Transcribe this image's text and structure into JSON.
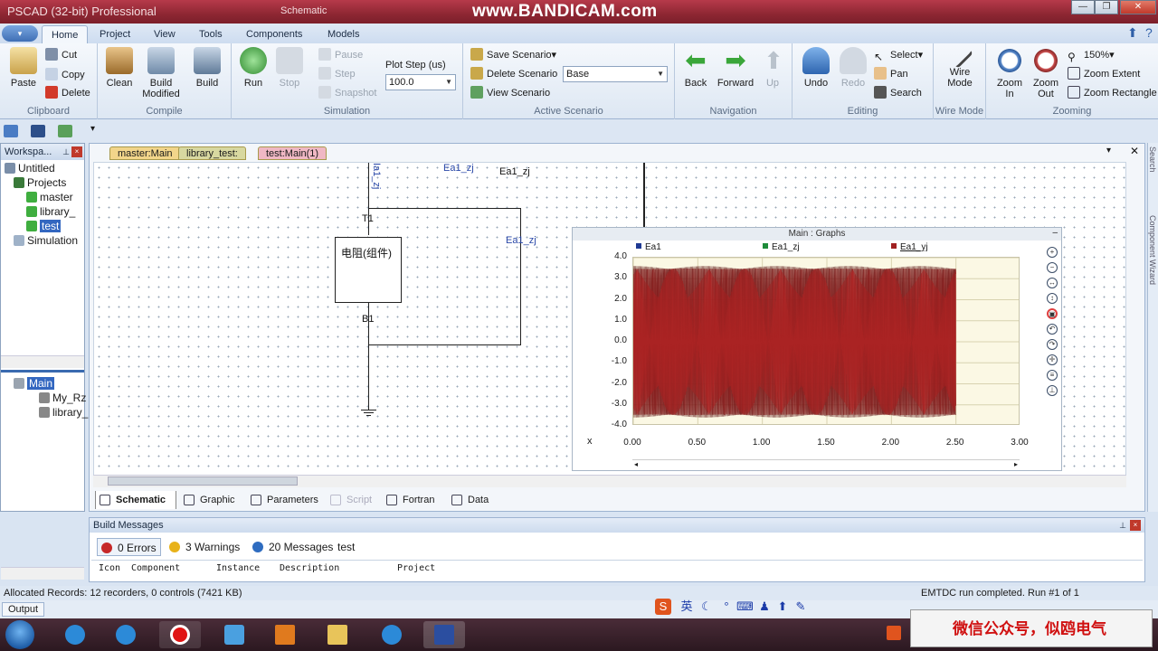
{
  "window": {
    "app_title": "PSCAD (32-bit) Professional",
    "doc_title": "Schematic",
    "watermark": "www.BANDICAM.com"
  },
  "ribbon_tabs": [
    "Home",
    "Project",
    "View",
    "Tools",
    "Components",
    "Models"
  ],
  "ribbon": {
    "clipboard": {
      "label": "Clipboard",
      "paste": "Paste",
      "cut": "Cut",
      "copy": "Copy",
      "delete": "Delete"
    },
    "compile": {
      "label": "Compile",
      "clean": "Clean",
      "build_modified_1": "Build",
      "build_modified_2": "Modified",
      "build": "Build"
    },
    "simulation": {
      "label": "Simulation",
      "run": "Run",
      "stop": "Stop",
      "pause": "Pause",
      "step": "Step",
      "snapshot": "Snapshot",
      "plot_step_label": "Plot Step (us)",
      "plot_step_value": "100.0"
    },
    "active_scenario": {
      "label": "Active Scenario",
      "save": "Save Scenario",
      "delete": "Delete Scenario",
      "view": "View Scenario",
      "current": "Base"
    },
    "navigation": {
      "label": "Navigation",
      "back": "Back",
      "forward": "Forward",
      "up": "Up"
    },
    "editing": {
      "label": "Editing",
      "undo": "Undo",
      "redo": "Redo",
      "select": "Select",
      "pan": "Pan",
      "search": "Search"
    },
    "wire_mode": {
      "label": "Wire Mode",
      "btn1": "Wire",
      "btn2": "Mode"
    },
    "zooming": {
      "label": "Zooming",
      "zoom_in_1": "Zoom",
      "zoom_in_2": "In",
      "zoom_out_1": "Zoom",
      "zoom_out_2": "Out",
      "zoom_level": "150%",
      "zoom_extent": "Zoom Extent",
      "zoom_rectangle": "Zoom Rectangle"
    }
  },
  "workspace": {
    "title": "Workspa...",
    "tree": [
      "Untitled",
      "Projects",
      "master",
      "library_",
      "test",
      "Simulation"
    ],
    "lower_tree": [
      "Main",
      "My_Rz",
      "library_"
    ]
  },
  "doc_tabs": [
    "master:Main",
    "library_test:",
    "test:Main(1)"
  ],
  "schematic": {
    "labels": {
      "ia": "Ia1_zj",
      "ea_top_blue": "Ea1_zj",
      "ea_top_black": "Ea1_zj",
      "ea_right": "Ea1_zj",
      "t1": "T1",
      "b1": "B1",
      "component": "电阻(组件)"
    }
  },
  "graph": {
    "title": "Main : Graphs",
    "x_symbol": "x"
  },
  "chart_data": {
    "type": "line",
    "title": "Main : Graphs",
    "xlabel": "x",
    "ylabel": "",
    "xlim": [
      0.0,
      3.0
    ],
    "ylim": [
      -4.0,
      4.0
    ],
    "x_ticks": [
      "0.00",
      "0.50",
      "1.00",
      "1.50",
      "2.00",
      "2.50",
      "3.00"
    ],
    "y_ticks": [
      "4.0",
      "3.0",
      "2.0",
      "1.0",
      "0.0",
      "-1.0",
      "-2.0",
      "-3.0",
      "-4.0"
    ],
    "series": [
      {
        "name": "Ea1",
        "color": "#1f3a93",
        "amplitude": 3.6,
        "x_range": [
          0.0,
          2.5
        ]
      },
      {
        "name": "Ea1_zj",
        "color": "#1e8c3a",
        "amplitude": 3.6,
        "x_range": [
          0.0,
          2.5
        ]
      },
      {
        "name": "Ea1_yj",
        "color": "#a02020",
        "amplitude": 3.6,
        "x_range": [
          0.0,
          2.5
        ]
      }
    ],
    "grid": true,
    "legend": "top"
  },
  "bottom_tabs": [
    "Schematic",
    "Graphic",
    "Parameters",
    "Script",
    "Fortran",
    "Data"
  ],
  "build_messages": {
    "title": "Build Messages",
    "errors": "0 Errors",
    "warnings": "3 Warnings",
    "messages": "20 Messages",
    "project": "test",
    "columns": [
      "Icon",
      "Component",
      "Instance",
      "Description",
      "Project"
    ]
  },
  "status": {
    "left": "Allocated Records: 12 recorders, 0 controls (7421 KB)",
    "right_1": "EMTDC run completed.",
    "right_2": "Run #1 of 1",
    "output_tab": "Output"
  },
  "ime": {
    "lang": "英"
  },
  "side_panels": [
    "Search",
    "Component Wizard"
  ],
  "wechat_banner": "微信公众号，似鸥电气"
}
